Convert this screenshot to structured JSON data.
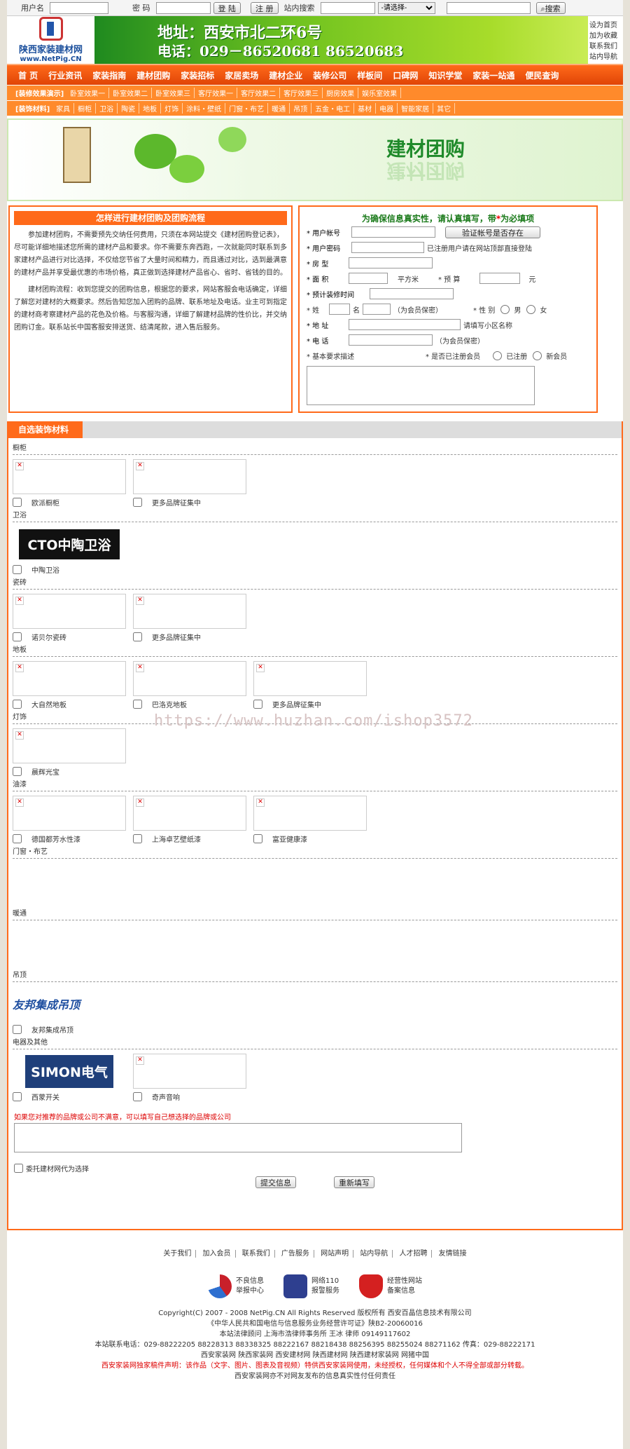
{
  "topbar": {
    "user_label": "用户名",
    "pass_label": "密 码",
    "login": "登 陆",
    "register": "注 册",
    "search_label": "站内搜索",
    "select_value": "-请选择-",
    "search_btn": "搜索"
  },
  "header": {
    "logo_cn": "陕西家装建材网",
    "logo_url": "www.NetPig.CN",
    "address": "地址：西安市北二环6号",
    "phone": "电话：029－86520681 86520683",
    "side_links": [
      "设为首页",
      "加为收藏",
      "联系我们",
      "站内导航"
    ]
  },
  "nav": [
    "首 页",
    "行业资讯",
    "家装指南",
    "建材团购",
    "家装招标",
    "家居卖场",
    "建材企业",
    "装修公司",
    "样板间",
    "口碑网",
    "知识学堂",
    "家装一站通",
    "便民查询"
  ],
  "subnav1": {
    "title": "[装修效果演示]",
    "items": [
      "卧室效果一",
      "卧室效果二",
      "卧室效果三",
      "客厅效果一",
      "客厅效果二",
      "客厅效果三",
      "厨房效果",
      "娱乐室效果"
    ]
  },
  "subnav2": {
    "title": "[装饰材料]",
    "items": [
      "家具",
      "橱柜",
      "卫浴",
      "陶瓷",
      "地板",
      "灯饰",
      "涂料・壁纸",
      "门窗・布艺",
      "暖通",
      "吊顶",
      "五金・电工",
      "基材",
      "电器",
      "智能家居",
      "其它"
    ]
  },
  "banner_title": "建材团购",
  "flow": {
    "heading": "怎样进行建材团购及团购流程",
    "p1": "参加建材团购，不需要预先交纳任何费用，只须在本网站提交《建材团购登记表》，尽可能详细地描述您所需的建材产品和要求。你不需要东奔西跑，一次就能同时联系到多家建材产品进行对比选择，不仅给您节省了大量时间和精力，而且通过对比，选到最满意的建材产品并享受最优惠的市场价格，真正做到选择建材产品省心、省时、省钱的目的。",
    "p2": "建材团购流程：收到您提交的团购信息，根据您的要求，网站客服会电话确定，详细了解您对建材的大概要求。然后告知您加入团购的品牌、联系地址及电话。业主可到指定的建材商考察建材产品的花色及价格。与客服沟通，详细了解建材品牌的性价比，并交纳团购订金。联系站长中国客服安排送货、结清尾款，进入售后服务。"
  },
  "form": {
    "title_a": "为确保信息真实性，请认真填写，带",
    "title_star": "*",
    "title_b": "为必填项",
    "account": "* 用户帐号",
    "verify": "验证帐号是否存在",
    "password": "* 用户密码",
    "pwd_hint": "已注册用户请在网站顶部直接登陆",
    "house": "* 房  型",
    "area": "* 面  积",
    "area_unit": "平方米",
    "budget": "* 预 算",
    "budget_unit": "元",
    "time": "* 预计装修时间",
    "surname": "* 姓",
    "name": "名",
    "privacy": "（为会员保密）",
    "gender": "* 性 别",
    "male": "男",
    "female": "女",
    "addr": "* 地 址",
    "addr_hint": "请填写小区名称",
    "tel": "* 电 话",
    "tel_hint": "（为会员保密）",
    "desc": "* 基本要求描述",
    "member_q": "* 是否已注册会员",
    "reg_yes": "已注册",
    "reg_new": "新会员"
  },
  "select": {
    "heading": "自选装饰材料",
    "cats": [
      {
        "name": "橱柜",
        "items": [
          {
            "label": "欧派橱柜"
          },
          {
            "label": "更多品牌征集中"
          }
        ]
      },
      {
        "name": "卫浴",
        "items": [
          {
            "label": "中陶卫浴",
            "brand": "CTO中陶卫浴"
          }
        ]
      },
      {
        "name": "瓷砖",
        "items": [
          {
            "label": "诺贝尔瓷砖"
          },
          {
            "label": "更多品牌征集中"
          }
        ]
      },
      {
        "name": "地板",
        "items": [
          {
            "label": "大自然地板"
          },
          {
            "label": "巴洛克地板"
          },
          {
            "label": "更多品牌征集中"
          }
        ]
      },
      {
        "name": "灯饰",
        "items": [
          {
            "label": "晨辉光宝"
          }
        ]
      },
      {
        "name": "油漆",
        "items": [
          {
            "label": "德国都芳水性漆"
          },
          {
            "label": "上海卓艺壁纸漆"
          },
          {
            "label": "富亚健康漆"
          }
        ]
      },
      {
        "name": "门窗・布艺",
        "items": []
      },
      {
        "name": "暖通",
        "items": []
      },
      {
        "name": "吊顶",
        "items": [
          {
            "label": "友邦集成吊顶",
            "brand": "友邦集成吊顶"
          }
        ]
      },
      {
        "name": "电器及其他",
        "items": [
          {
            "label": "西蒙开关",
            "brand": "SIMON电气"
          },
          {
            "label": "奇声音响"
          }
        ]
      }
    ],
    "note": "如果您对推荐的品牌或公司不满意，可以填写自己想选择的品牌或公司",
    "delegate": "委托建材网代为选择",
    "submit": "提交信息",
    "reset": "重新填写"
  },
  "watermark": "https://www.huzhan.com/ishop3572",
  "footer": {
    "links": [
      "关于我们",
      "加入会员",
      "联系我们",
      "广告服务",
      "网站声明",
      "站内导航",
      "人才招聘",
      "友情链接"
    ],
    "badges": [
      {
        "t1": "不良信息",
        "t2": "举报中心",
        "color": "#c8202a"
      },
      {
        "t1": "网络110",
        "t2": "报警服务",
        "color": "#2e3f8f"
      },
      {
        "t1": "经营性网站",
        "t2": "备案信息",
        "color": "#d42020"
      }
    ],
    "c1": "Copyright(C) 2007 - 2008 NetPig.CN All Rights Reserved 版权所有 西安百晶信息技术有限公司",
    "c2": "《中华人民共和国电信与信息服务业务经营许可证》陕B2-20060016",
    "c3": "本站法律顾问 上海市浩律师事务所 王冰 律师 09149117602",
    "c4": "本站联系电话：029-88222205 88228313 88338325 88222167 88218438 88256395 88255024 88271162 传真：029-88222171",
    "c5": "西安家装网 陕西家装网 西安建材网 陕西建材网 陕西建材家装网 网猪中国",
    "c6": "西安家装网独家稿件声明：该作品（文字、图片、图表及音视频）特供西安家装网使用，未经授权，任何媒体和个人不得全部或部分转载。",
    "c7": "西安家装网亦不对网友发布的信息真实性付任何责任"
  }
}
